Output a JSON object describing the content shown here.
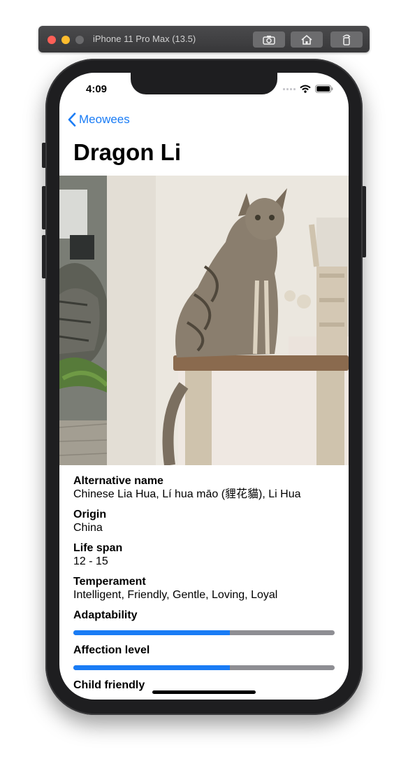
{
  "window": {
    "title": "iPhone 11 Pro Max (13.5)"
  },
  "toolbar": {
    "screenshot_icon": "camera-icon",
    "home_icon": "home-icon",
    "rotate_icon": "rotate-icon"
  },
  "status_bar": {
    "time": "4:09"
  },
  "nav": {
    "back_label": "Meowees",
    "title": "Dragon Li"
  },
  "details": {
    "alternative_name_label": "Alternative name",
    "alternative_name_value": "Chinese Lia Hua, Lí hua māo (貍花貓), Li Hua",
    "origin_label": "Origin",
    "origin_value": "China",
    "life_span_label": "Life span",
    "life_span_value": "12 - 15",
    "temperament_label": "Temperament",
    "temperament_value": "Intelligent, Friendly, Gentle, Loving, Loyal",
    "adaptability_label": "Adaptability",
    "adaptability_level": 0.6,
    "affection_label": "Affection level",
    "affection_level": 0.6,
    "child_friendly_label": "Child friendly"
  },
  "colors": {
    "accent": "#1a7cf5",
    "meter_track": "#8e8e93"
  }
}
